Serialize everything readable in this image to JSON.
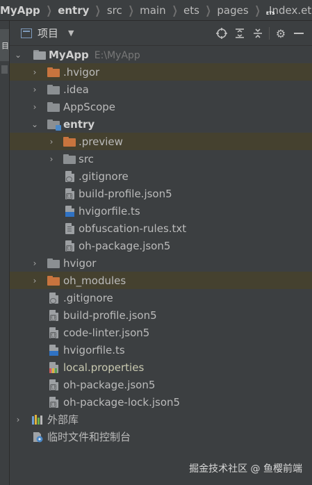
{
  "breadcrumb": [
    "MyApp",
    "entry",
    "src",
    "main",
    "ets",
    "pages",
    "Index.ets"
  ],
  "left_strip": {
    "tab_label": "目"
  },
  "panel": {
    "title": "项目"
  },
  "tree": {
    "root_label": "MyApp",
    "root_path": "E:\\MyApp",
    "hvigor_dot": ".hvigor",
    "idea": ".idea",
    "appscope": "AppScope",
    "entry": "entry",
    "preview": ".preview",
    "src": "src",
    "entry_gitignore": ".gitignore",
    "entry_build_profile": "build-profile.json5",
    "entry_hvigorfile": "hvigorfile.ts",
    "obfuscation": "obfuscation-rules.txt",
    "entry_oh_package": "oh-package.json5",
    "hvigor": "hvigor",
    "oh_modules": "oh_modules",
    "gitignore": ".gitignore",
    "build_profile": "build-profile.json5",
    "code_linter": "code-linter.json5",
    "hvigorfile": "hvigorfile.ts",
    "local_properties": "local.properties",
    "oh_package": "oh-package.json5",
    "oh_package_lock": "oh-package-lock.json5",
    "external_libs": "外部库",
    "scratches": "临时文件和控制台"
  },
  "watermark": "掘金技术社区 @ 鱼樱前端",
  "colors": {
    "background": "#3c3f41",
    "highlight_row": "#45412f",
    "excluded_folder": "#c8743e",
    "ts_badge": "#2f72c4"
  }
}
